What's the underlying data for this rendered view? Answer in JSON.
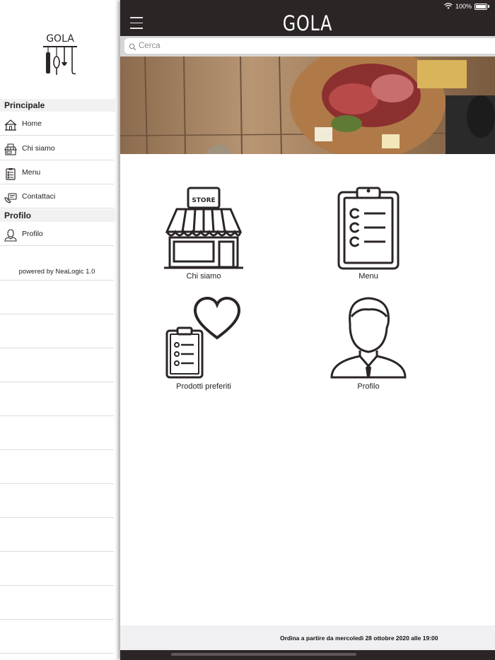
{
  "status_bar": {
    "battery": "100%"
  },
  "sidebar": {
    "logo_text": "GOLA",
    "sections": [
      {
        "title": "Principale",
        "items": [
          {
            "label": "Home",
            "icon": "house-icon"
          },
          {
            "label": "Chi siamo",
            "icon": "store-icon"
          },
          {
            "label": "Menu",
            "icon": "clipboard-icon"
          },
          {
            "label": "Contattaci",
            "icon": "contact-icon"
          }
        ]
      },
      {
        "title": "Profilo",
        "items": [
          {
            "label": "Profilo",
            "icon": "user-icon"
          }
        ]
      }
    ],
    "powered_by": "powered by NeaLogic 1.0"
  },
  "header": {
    "title": "GOLA",
    "menu_icon": "hamburger-icon"
  },
  "search": {
    "placeholder": "Cerca",
    "icon": "search-icon"
  },
  "hero": {
    "description_icon": "charcuterie-banner-image"
  },
  "tiles": [
    {
      "label": "Chi siamo",
      "icon": "store-icon",
      "icon_text": "STORE"
    },
    {
      "label": "Menu",
      "icon": "clipboard-icon"
    },
    {
      "label": "Prodotti preferiti",
      "icon": "favorite-clipboard-icon"
    },
    {
      "label": "Profilo",
      "icon": "user-icon"
    }
  ],
  "footer": {
    "text": "Ordina a partire da mercoledì 28 ottobre 2020 alle 19:00"
  },
  "colors": {
    "topbar": "#2b2526",
    "sidebar_section": "#f1f1f1",
    "icon_stroke": "#2b2526"
  }
}
